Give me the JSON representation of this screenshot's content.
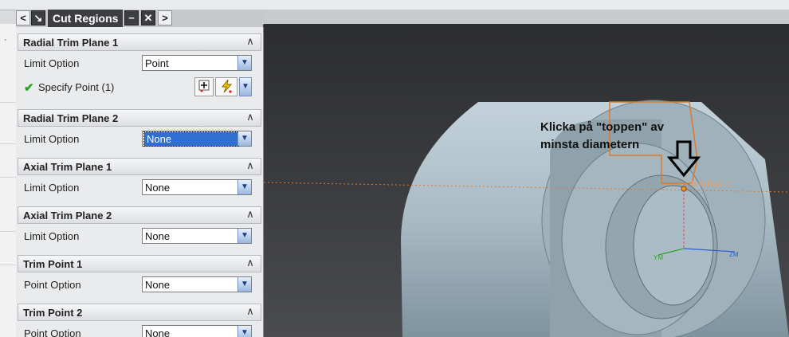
{
  "dialog": {
    "title": "Cut Regions",
    "groups": [
      {
        "title": "Radial Trim Plane 1",
        "rows": [
          {
            "label": "Limit Option",
            "value": "Point"
          },
          {
            "label": "Specify Point (1)"
          }
        ]
      },
      {
        "title": "Radial Trim Plane 2",
        "rows": [
          {
            "label": "Limit Option",
            "value": "None"
          }
        ]
      },
      {
        "title": "Axial Trim Plane 1",
        "rows": [
          {
            "label": "Limit Option",
            "value": "None"
          }
        ]
      },
      {
        "title": "Axial Trim Plane 2",
        "rows": [
          {
            "label": "Limit Option",
            "value": "None"
          }
        ]
      },
      {
        "title": "Trim Point 1",
        "rows": [
          {
            "label": "Point Option",
            "value": "None"
          }
        ]
      },
      {
        "title": "Trim Point 2",
        "rows": [
          {
            "label": "Point Option",
            "value": "None"
          }
        ]
      }
    ]
  },
  "viewport": {
    "annotation_line1": "Klicka på \"toppen\" av",
    "annotation_line2": "minsta diametern",
    "radial_label": "Radial 1",
    "axis_ym": "YM",
    "axis_zm": "ZM"
  },
  "colors": {
    "accent_check": "#24a524",
    "selection": "#2f6fd0",
    "model_fill": "#a9bcc6",
    "trim_orange": "#e0782c"
  }
}
